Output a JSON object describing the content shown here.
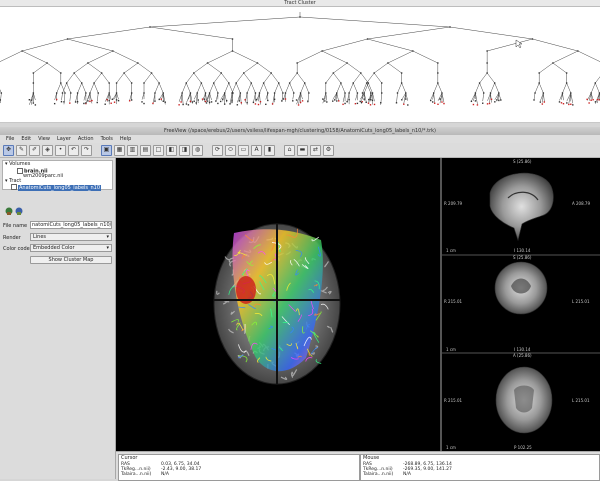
{
  "tract_cluster": {
    "title": "Tract Cluster"
  },
  "freeview": {
    "title": "FreeView (/space/erebus/2/users/vsiless/lifespan-mgh/clustering/0158/AnatomiCuts_long05_labels_n10/*.trk)"
  },
  "menu": [
    "File",
    "Edit",
    "View",
    "Layer",
    "Action",
    "Tools",
    "Help"
  ],
  "toolbar_icons": [
    "navigate-icon",
    "recon-edit-icon",
    "voxel-edit-icon",
    "roi-edit-icon",
    "point-set-icon",
    "undo-icon",
    "redo-icon",
    "layout-1x1-icon",
    "layout-2x2-icon",
    "layout-1-3-icon",
    "layout-1-3h-icon",
    "main-view-sagittal-icon",
    "main-view-coronal-icon",
    "main-view-axial-icon",
    "main-view-3d-icon",
    "reset-view-icon",
    "surface-icon",
    "volume-icon",
    "colorbar-icon",
    "annotation-icon",
    "screenshot-icon",
    "toggle-icon",
    "sync-icon",
    "settings-icon"
  ],
  "layers": {
    "volumes_label": "Volumes",
    "volume_items": [
      "brain.nii",
      "wm2009parc.nii"
    ],
    "tract_label": "Tract",
    "tract_item": "AnatomiCuts_long05_labels_n10"
  },
  "properties": {
    "file_name_label": "File name",
    "file_name_value": "natomiCuts_long05_labels_n10/*.trk",
    "render_label": "Render",
    "render_value": "Lines",
    "color_code_label": "Color code",
    "color_code_value": "Embedded Color",
    "show_cluster_button": "Show Cluster Map"
  },
  "views": {
    "sagittal": {
      "top": "S (25.86)",
      "left": "R 209.79",
      "right": "A 208.79",
      "bottom": "I 130.14",
      "scale": "1 cm"
    },
    "coronal": {
      "top": "S (25.86)",
      "left": "R 215.01",
      "right": "L 215.01",
      "bottom": "I 130.14",
      "scale": "1 cm"
    },
    "axial": {
      "top": "A (25.86)",
      "left": "R 215.01",
      "right": "L 215.01",
      "bottom": "P 102.25",
      "scale": "1 cm"
    }
  },
  "cursor_panel": {
    "title": "Cursor",
    "rows": [
      {
        "label": "RAS",
        "value": "0.03, 6.75, 34.04"
      },
      {
        "label": "TkReg...n.nii)",
        "value": "-2.43, 9.00, 38.17"
      },
      {
        "label": "Talaira...n.nii)",
        "value": "N/A"
      }
    ]
  },
  "mouse_panel": {
    "title": "Mouse",
    "rows": [
      {
        "label": "RAS",
        "value": "-268.89, 6.75, 136.14"
      },
      {
        "label": "TkReg...n.nii)",
        "value": "-269.35, 9.00, 141.27"
      },
      {
        "label": "Talaira...n.nii)",
        "value": "N/A"
      }
    ]
  },
  "colors": {
    "selection": "#3d6fb6",
    "dendrogram_lines": "#444444",
    "red_nodes": "#cc2222",
    "viewer_bg": "#000000"
  }
}
